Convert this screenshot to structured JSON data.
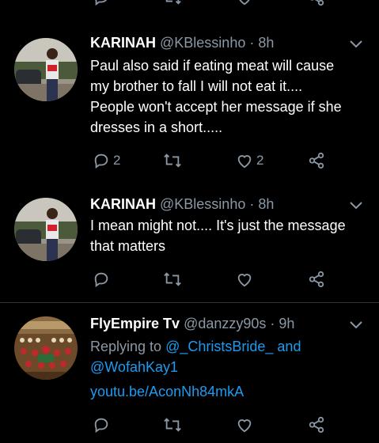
{
  "colors": {
    "background": "#000000",
    "muted": "#8b98a5",
    "link": "#1d9bf0",
    "divider": "#2f3336"
  },
  "tweets": [
    {
      "name": "KARINAH",
      "handle": "@KBlessinho",
      "time": "· 8h",
      "text_lines": [
        "Paul also said if eating meat will cause",
        "my brother to fall I will not eat it....",
        "People won't accept her message if she",
        "dresses in a short....."
      ],
      "reply_count": "2",
      "like_count": "2"
    },
    {
      "name": "KARINAH",
      "handle": "@KBlessinho",
      "time": "· 8h",
      "text_lines": [
        "I mean might not.... It's just the message",
        "that matters"
      ],
      "reply_count": "",
      "like_count": ""
    },
    {
      "name": "FlyEmpire Tv",
      "handle": "@danzzy90s",
      "time": "· 9h",
      "replying_prefix": "Replying to",
      "replying_user1": "@_ChristsBride_",
      "replying_and": "and",
      "replying_user2": "@WofahKay1",
      "link": "youtu.be/AconNh84mkA",
      "reply_count": "",
      "like_count": ""
    }
  ],
  "icons": [
    "reply-icon",
    "retweet-icon",
    "like-icon",
    "share-icon",
    "caret-down-icon"
  ]
}
